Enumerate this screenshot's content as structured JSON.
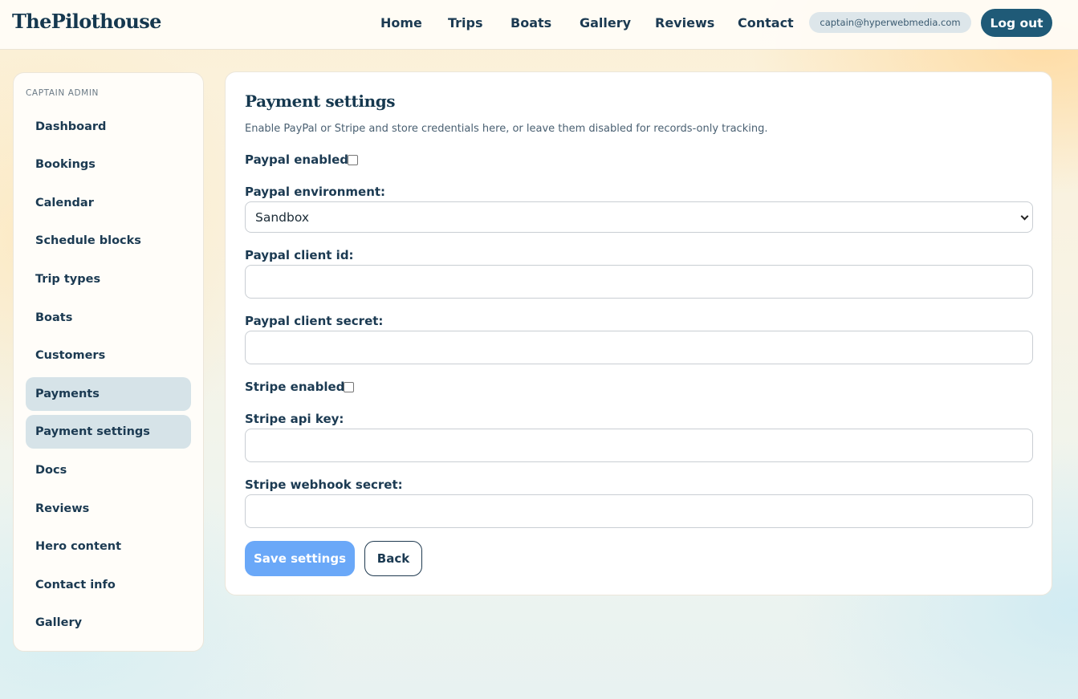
{
  "header": {
    "brand": "ThePilothouse",
    "nav": {
      "home": "Home",
      "trips": "Trips",
      "boats": "Boats",
      "gallery": "Gallery",
      "reviews": "Reviews",
      "contact": "Contact"
    },
    "user_email": "captain@hyperwebmedia.com",
    "logout_label": "Log out"
  },
  "sidebar": {
    "heading": "Captain admin",
    "items": [
      {
        "label": "Dashboard",
        "active": false
      },
      {
        "label": "Bookings",
        "active": false
      },
      {
        "label": "Calendar",
        "active": false
      },
      {
        "label": "Schedule blocks",
        "active": false
      },
      {
        "label": "Trip types",
        "active": false
      },
      {
        "label": "Boats",
        "active": false
      },
      {
        "label": "Customers",
        "active": false
      },
      {
        "label": "Payments",
        "active": true
      },
      {
        "label": "Payment settings",
        "active": true
      },
      {
        "label": "Docs",
        "active": false
      },
      {
        "label": "Reviews",
        "active": false
      },
      {
        "label": "Hero content",
        "active": false
      },
      {
        "label": "Contact info",
        "active": false
      },
      {
        "label": "Gallery",
        "active": false
      }
    ]
  },
  "main": {
    "title": "Payment settings",
    "description": "Enable PayPal or Stripe and store credentials here, or leave them disabled for records-only tracking.",
    "form": {
      "paypal_enabled_label": "Paypal enabled:",
      "paypal_enabled": false,
      "paypal_environment_label": "Paypal environment:",
      "paypal_environment_value": "Sandbox",
      "paypal_client_id_label": "Paypal client id:",
      "paypal_client_id_value": "",
      "paypal_client_secret_label": "Paypal client secret:",
      "paypal_client_secret_value": "",
      "stripe_enabled_label": "Stripe enabled:",
      "stripe_enabled": false,
      "stripe_api_key_label": "Stripe api key:",
      "stripe_api_key_value": "",
      "stripe_webhook_secret_label": "Stripe webhook secret:",
      "stripe_webhook_secret_value": ""
    },
    "save_label": "Save settings",
    "back_label": "Back"
  },
  "colors": {
    "accent": "#1f5a77",
    "primary_button": "#6aa8f8",
    "active_item": "#d6e3e8",
    "text": "#1b3a52"
  }
}
